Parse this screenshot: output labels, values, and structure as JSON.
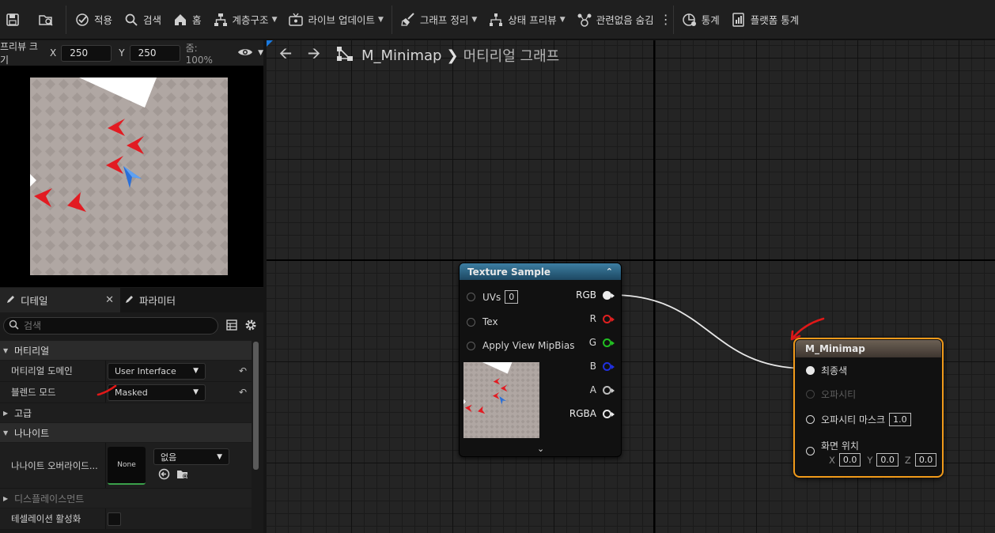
{
  "colors": {
    "accent_orange": "#f19a1a",
    "texture_header": "#2b6888",
    "panel_bg": "#1a1a1a",
    "graph_bg": "#242424",
    "pin_red": "#e02020",
    "pin_green": "#22c022",
    "pin_blue": "#2030e0"
  },
  "toolbar": {
    "apply": "적용",
    "search": "검색",
    "home": "홈",
    "hierarchy": "계층구조",
    "live_update": "라이브 업데이트",
    "graph_cleanup": "그래프 정리",
    "state_preview": "상태 프리뷰",
    "hide_unrelated": "관련없음 숨김",
    "stats": "통계",
    "platform_stats": "플랫폼 통계"
  },
  "preview": {
    "size_label": "프리뷰 크기",
    "x_label": "X",
    "x_value": "250",
    "y_label": "Y",
    "y_value": "250",
    "zoom": "줌: 100%"
  },
  "details": {
    "tab_details": "디테일",
    "tab_params": "파라미터",
    "search_placeholder": "검색",
    "section_material": "머티리얼",
    "domain_label": "머티리얼 도메인",
    "domain_value": "User Interface",
    "blend_label": "블렌드 모드",
    "blend_value": "Masked",
    "section_advanced": "고급",
    "section_nanite": "나나이트",
    "nanite_override_label": "나나이트 오버라이드...",
    "nanite_thumb": "None",
    "nanite_value": "없음",
    "section_displacement": "디스플레이스먼트",
    "tessellation_label": "테셀레이션 활성화"
  },
  "graph": {
    "asset": "M_Minimap",
    "subtitle": "머티리얼 그래프",
    "texture_node": {
      "title": "Texture Sample",
      "uvs": "UVs",
      "uvs_value": "0",
      "tex": "Tex",
      "mipbias": "Apply View MipBias",
      "rgb": "RGB",
      "r": "R",
      "g": "G",
      "b": "B",
      "a": "A",
      "rgba": "RGBA"
    },
    "result_node": {
      "title": "M_Minimap",
      "final_color": "최종색",
      "opacity": "오파시티",
      "opacity_mask": "오파시티 마스크",
      "opacity_mask_value": "1.0",
      "screen_position": "화면 위치",
      "x_label": "X",
      "x_value": "0.0",
      "y_label": "Y",
      "y_value": "0.0",
      "z_label": "Z",
      "z_value": "0.0"
    }
  }
}
